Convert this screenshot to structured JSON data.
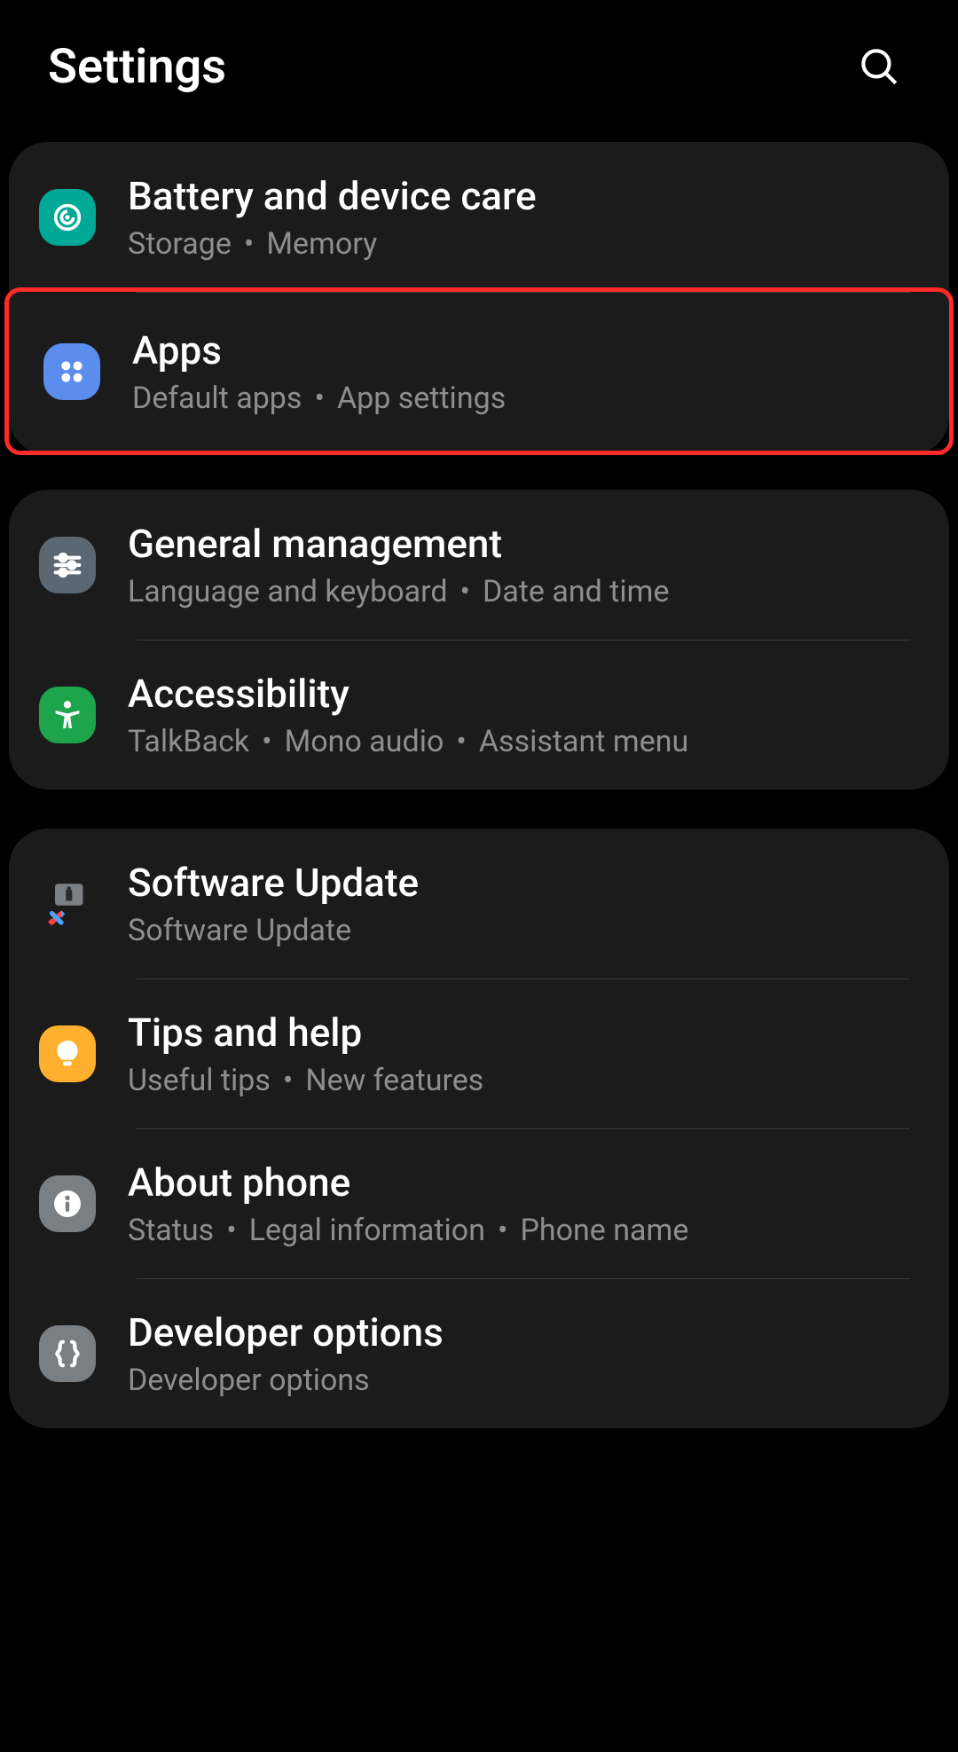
{
  "header": {
    "title": "Settings"
  },
  "sep": "•",
  "groups": [
    {
      "items": [
        {
          "id": "battery",
          "title": "Battery and device care",
          "sub": [
            "Storage",
            "Memory"
          ],
          "iconClass": "ic-teal",
          "iconName": "device-care-icon",
          "highlight": false
        },
        {
          "id": "apps",
          "title": "Apps",
          "sub": [
            "Default apps",
            "App settings"
          ],
          "iconClass": "ic-blue",
          "iconName": "apps-icon",
          "highlight": true
        }
      ]
    },
    {
      "items": [
        {
          "id": "general",
          "title": "General management",
          "sub": [
            "Language and keyboard",
            "Date and time"
          ],
          "iconClass": "ic-slate",
          "iconName": "sliders-icon",
          "highlight": false
        },
        {
          "id": "accessibility",
          "title": "Accessibility",
          "sub": [
            "TalkBack",
            "Mono audio",
            "Assistant menu"
          ],
          "iconClass": "ic-green",
          "iconName": "accessibility-icon",
          "highlight": false
        }
      ]
    },
    {
      "items": [
        {
          "id": "software-update",
          "title": "Software Update",
          "sub": [
            "Software Update"
          ],
          "iconClass": "ic-none",
          "iconName": "update-icon",
          "highlight": false
        },
        {
          "id": "tips",
          "title": "Tips and help",
          "sub": [
            "Useful tips",
            "New features"
          ],
          "iconClass": "ic-orange",
          "iconName": "bulb-icon",
          "highlight": false
        },
        {
          "id": "about",
          "title": "About phone",
          "sub": [
            "Status",
            "Legal information",
            "Phone name"
          ],
          "iconClass": "ic-grey",
          "iconName": "info-icon",
          "highlight": false
        },
        {
          "id": "developer",
          "title": "Developer options",
          "sub": [
            "Developer options"
          ],
          "iconClass": "ic-grey",
          "iconName": "braces-icon",
          "highlight": false
        }
      ]
    }
  ]
}
